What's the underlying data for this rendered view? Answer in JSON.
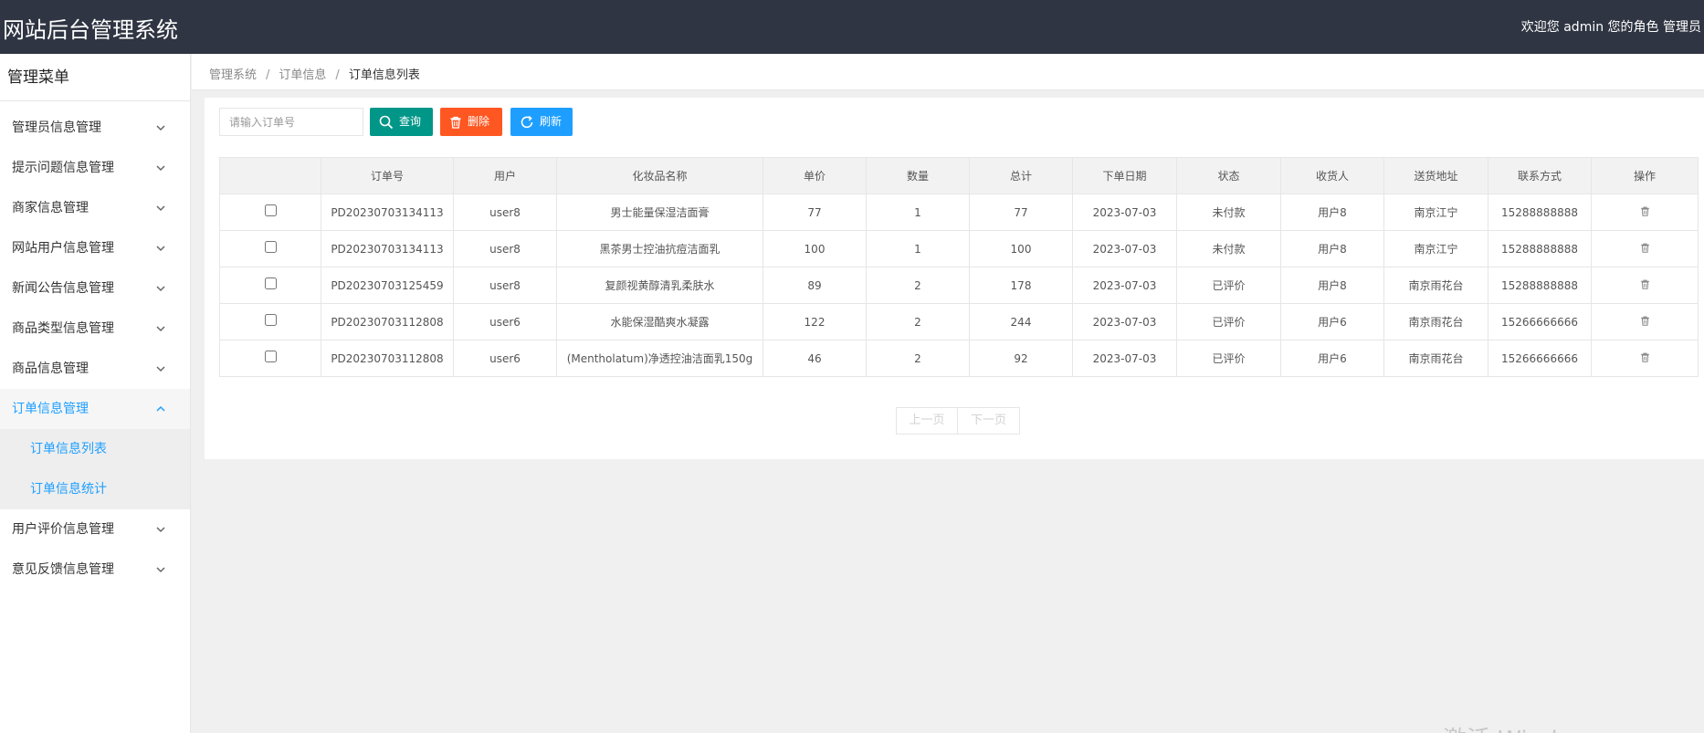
{
  "header": {
    "title": "网站后台管理系统",
    "welcome": "欢迎您 admin 您的角色 管理员"
  },
  "sidebar": {
    "title": "管理菜单",
    "items": [
      {
        "label": "管理员信息管理"
      },
      {
        "label": "提示问题信息管理"
      },
      {
        "label": "商家信息管理"
      },
      {
        "label": "网站用户信息管理"
      },
      {
        "label": "新闻公告信息管理"
      },
      {
        "label": "商品类型信息管理"
      },
      {
        "label": "商品信息管理"
      },
      {
        "label": "订单信息管理",
        "open": true
      },
      {
        "label": "用户评价信息管理"
      },
      {
        "label": "意见反馈信息管理"
      }
    ],
    "sub_items": [
      {
        "label": "订单信息列表"
      },
      {
        "label": "订单信息统计"
      }
    ]
  },
  "breadcrumb": {
    "items": [
      "管理系统",
      "订单信息",
      "订单信息列表"
    ],
    "separator": "/"
  },
  "toolbar": {
    "search_placeholder": "请输入订单号",
    "query_label": "查询",
    "delete_label": "删除",
    "refresh_label": "刷新"
  },
  "table": {
    "columns": [
      "",
      "订单号",
      "用户",
      "化妆品名称",
      "单价",
      "数量",
      "总计",
      "下单日期",
      "状态",
      "收货人",
      "送货地址",
      "联系方式",
      "操作"
    ],
    "rows": [
      [
        "PD20230703134113",
        "user8",
        "男士能量保湿洁面膏",
        "77",
        "1",
        "77",
        "2023-07-03",
        "未付款",
        "用户8",
        "南京江宁",
        "15288888888"
      ],
      [
        "PD20230703134113",
        "user8",
        "黑茶男士控油抗痘洁面乳",
        "100",
        "1",
        "100",
        "2023-07-03",
        "未付款",
        "用户8",
        "南京江宁",
        "15288888888"
      ],
      [
        "PD20230703125459",
        "user8",
        "复颜视黄醇清乳柔肤水",
        "89",
        "2",
        "178",
        "2023-07-03",
        "已评价",
        "用户8",
        "南京雨花台",
        "15288888888"
      ],
      [
        "PD20230703112808",
        "user6",
        "水能保湿酷爽水凝露",
        "122",
        "2",
        "244",
        "2023-07-03",
        "已评价",
        "用户6",
        "南京雨花台",
        "15266666666"
      ],
      [
        "PD20230703112808",
        "user6",
        "(Mentholatum)净透控油洁面乳150g",
        "46",
        "2",
        "92",
        "2023-07-03",
        "已评价",
        "用户6",
        "南京雨花台",
        "15266666666"
      ]
    ]
  },
  "pager": {
    "prev_label": "上一页",
    "next_label": "下一页"
  },
  "watermark": "激活 Windows",
  "colors": {
    "header_bg": "#2f3542",
    "query": "#009688",
    "delete": "#ff5722",
    "refresh": "#1e9fff",
    "active_menu": "#1e9fff"
  }
}
